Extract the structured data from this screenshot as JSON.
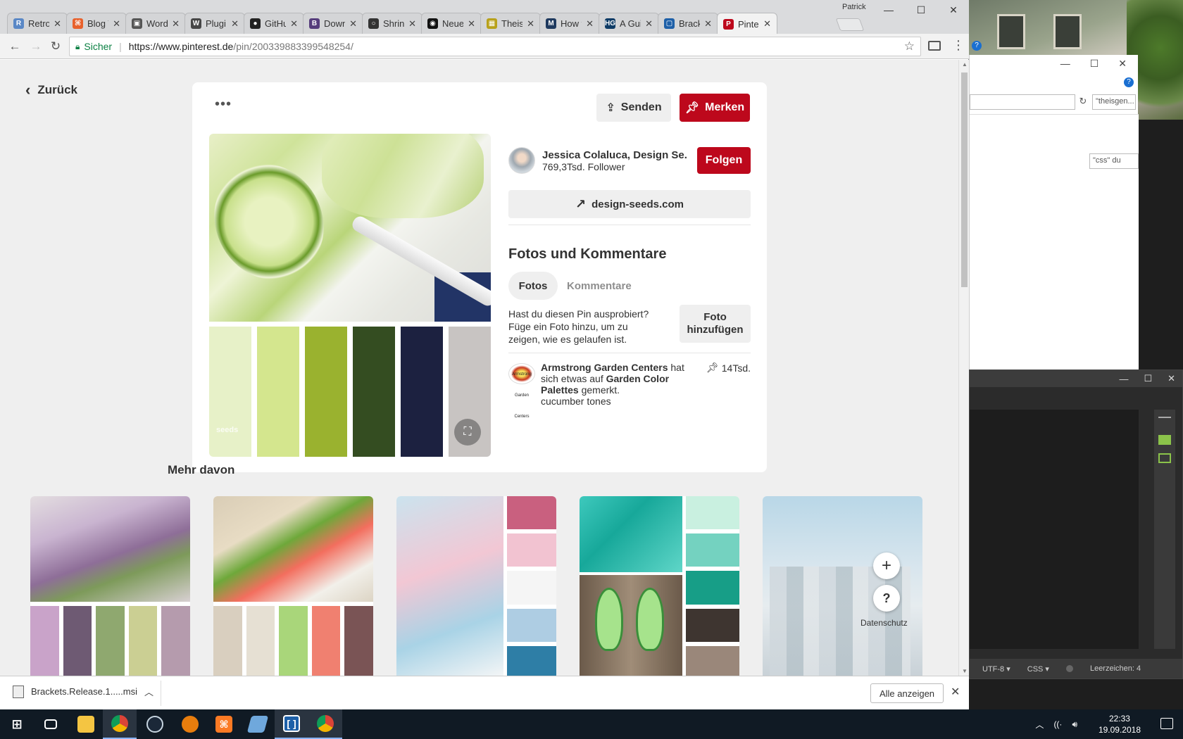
{
  "browser": {
    "profile_name": "Patrick",
    "tabs": [
      {
        "label": "Retro",
        "color": "#5a88c6",
        "letter": "R"
      },
      {
        "label": "Blog T",
        "color": "#e8612c",
        "letter": "⌘"
      },
      {
        "label": "Word",
        "color": "#555555",
        "letter": "▣"
      },
      {
        "label": "Plugi",
        "color": "#464646",
        "letter": "W"
      },
      {
        "label": "GitHu",
        "color": "#222222",
        "letter": "●"
      },
      {
        "label": "Down",
        "color": "#563d7c",
        "letter": "B"
      },
      {
        "label": "Shrin",
        "color": "#333333",
        "letter": "○"
      },
      {
        "label": "Neue",
        "color": "#111111",
        "letter": "◉"
      },
      {
        "label": "Theis",
        "color": "#b8a11a",
        "letter": "▦"
      },
      {
        "label": "How t",
        "color": "#1f3a5f",
        "letter": "M"
      },
      {
        "label": "A Gui",
        "color": "#0d3b66",
        "letter": "HG"
      },
      {
        "label": "Brack",
        "color": "#1e60a8",
        "letter": "▢"
      },
      {
        "label": "Pinter",
        "color": "#bd081c",
        "letter": "P"
      }
    ],
    "secure_label": "Sicher",
    "url_main": "https://www.pinterest.de",
    "url_rest": "/pin/200339883399548254/"
  },
  "page": {
    "back_label": "Zurück",
    "send_label": "Senden",
    "save_label": "Merken",
    "creator_name": "Jessica Colaluca, Design Se...",
    "creator_followers": "769,3Tsd. Follower",
    "follow_label": "Folgen",
    "site_link": "design-seeds.com",
    "comments_title": "Fotos und Kommentare",
    "tab_photos": "Fotos",
    "tab_comments": "Kommentare",
    "tried_text": "Hast du diesen Pin ausprobiert? Füge ein Foto hinzu, um zu zeigen, wie es gelaufen ist.",
    "add_photo_label": "Foto hinzufügen",
    "activity_user": "Armstrong Garden Centers",
    "activity_mid": " hat sich etwas auf ",
    "activity_board": "Garden Color Palettes",
    "activity_end": " gemerkt.",
    "activity_desc": "cucumber tones",
    "activity_count": "14Tsd.",
    "activity_avatar_text": "Armstrong Garden Centers",
    "palette_colors": [
      "#e7f1c8",
      "#d4e68e",
      "#9ab22f",
      "#344d21",
      "#1c2140",
      "#c8c4c2"
    ],
    "seeds_logo": "seeds",
    "more_title": "Mehr davon",
    "privacy_label": "Datenschutz"
  },
  "grid": {
    "card1_palette": [
      "#c9a3c9",
      "#6e5a73",
      "#8fa86f",
      "#cbcf93",
      "#b59bad"
    ],
    "card2_palette": [
      "#d9cfbf",
      "#e6e0d3",
      "#a9d67a",
      "#f08070",
      "#7a5455"
    ],
    "card3_palette": [
      "#c9607f",
      "#f2c3d1",
      "#f5f5f5",
      "#aecde3",
      "#2e7ea6"
    ],
    "card4_palette": [
      "#c9f0e0",
      "#74d2c0",
      "#179e87",
      "#3e3530",
      "#9a877a"
    ]
  },
  "download": {
    "filename": "Brackets.Release.1.....msi",
    "show_all_label": "Alle anzeigen"
  },
  "explorer": {
    "search_placeholder": "\"theisgen...",
    "css_search": "\"css\" du"
  },
  "brackets": {
    "encoding": "UTF-8",
    "language": "CSS",
    "indent": "Leerzeichen: 4"
  },
  "taskbar": {
    "time": "22:33",
    "date": "19.09.2018"
  }
}
